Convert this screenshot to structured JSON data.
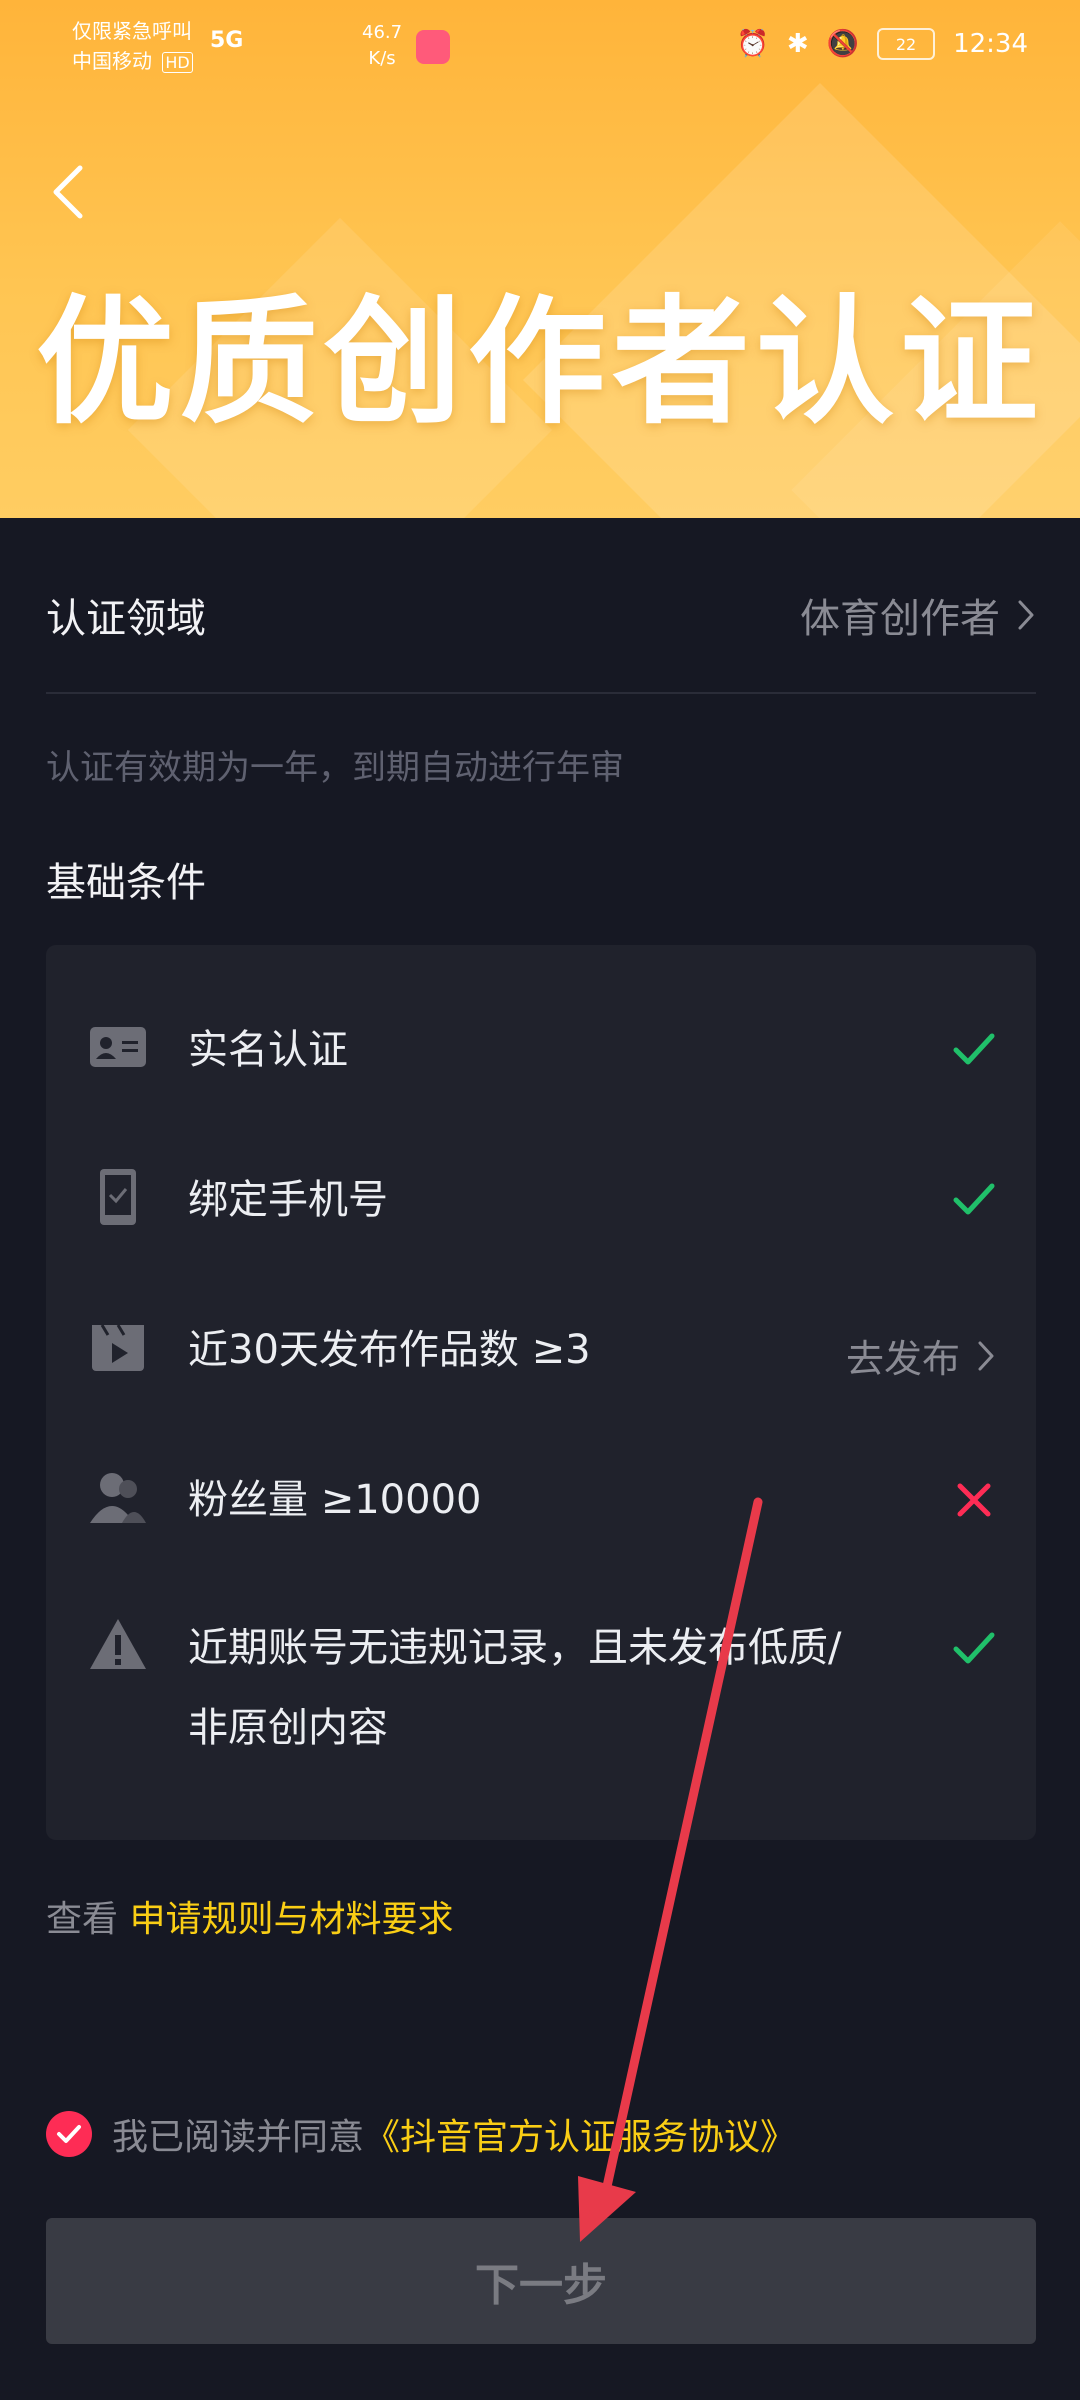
{
  "status_bar": {
    "carrier_line1": "仅限紧急呼叫",
    "carrier_line2": "中国移动",
    "hd_badge": "HD",
    "network": "5G",
    "speed_value": "46.7",
    "speed_unit": "K/s",
    "battery": "22",
    "time": "12:34"
  },
  "header": {
    "title": "优质创作者认证",
    "back_icon": "chevron-left-icon"
  },
  "field": {
    "label": "认证领域",
    "value": "体育创作者"
  },
  "note": "认证有效期为一年，到期自动进行年审",
  "section_title": "基础条件",
  "conditions": [
    {
      "icon": "id-card-icon",
      "text": "实名认证",
      "status": "done"
    },
    {
      "icon": "phone-icon",
      "text": "绑定手机号",
      "status": "done"
    },
    {
      "icon": "video-icon",
      "text": "近30天发布作品数 ≥3",
      "action": "去发布"
    },
    {
      "icon": "users-icon",
      "text": "粉丝量 ≥10000",
      "status": "fail"
    },
    {
      "icon": "warning-icon",
      "text_line1": "近期账号无违规记录，且未发布低质/",
      "text_line2": "非原创内容",
      "status": "done"
    }
  ],
  "rules": {
    "prefix": "查看",
    "link": "申请规则与材料要求"
  },
  "agreement": {
    "prefix": "我已阅读并同意",
    "link": "《抖音官方认证服务协议》",
    "checked": true
  },
  "next_button": "下一步",
  "colors": {
    "background": "#161823",
    "card": "#20222c",
    "accent_yellow": "#face15",
    "success_green": "#20c06a",
    "fail_red": "#fe2c55",
    "annotation_arrow": "#e83a4a"
  }
}
